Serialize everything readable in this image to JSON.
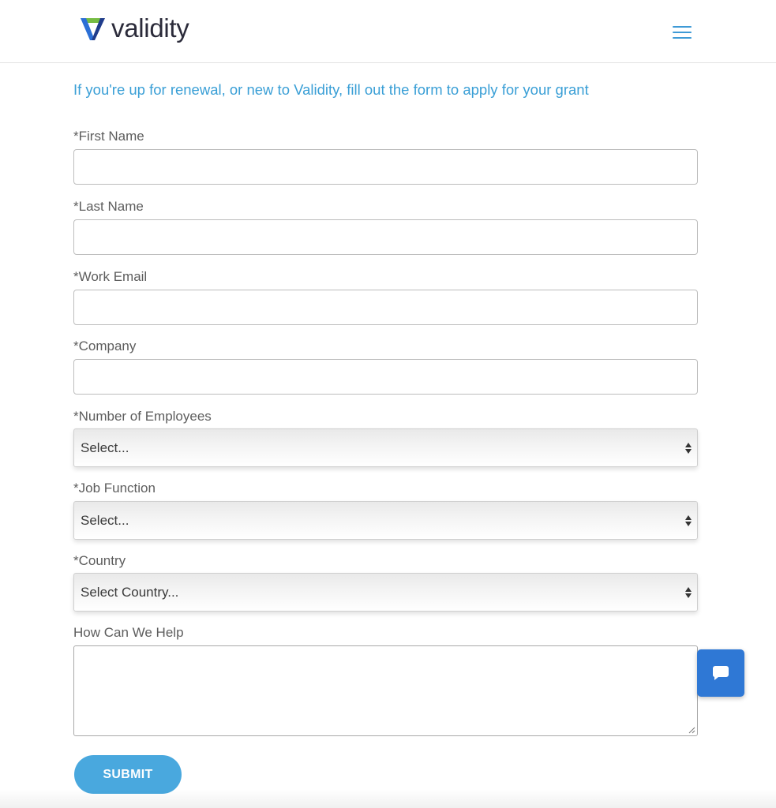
{
  "header": {
    "brand": "validity",
    "brand_colors": {
      "green": "#76bc43",
      "blue": "#2b6fd6",
      "navy": "#1f3c8c"
    },
    "menu_icon": "hamburger-menu-icon"
  },
  "intro_text": "If you're up for renewal, or new to Validity, fill out the form to apply for your grant",
  "form": {
    "first_name_label": "*First Name",
    "first_name_value": "",
    "last_name_label": "*Last Name",
    "last_name_value": "",
    "work_email_label": "*Work Email",
    "work_email_value": "",
    "company_label": "*Company",
    "company_value": "",
    "employees_label": "*Number of Employees",
    "employees_selected": "Select...",
    "job_function_label": "*Job Function",
    "job_function_selected": "Select...",
    "country_label": "*Country",
    "country_selected": "Select Country...",
    "help_label": "How Can We Help",
    "help_value": "",
    "submit_label": "SUBMIT"
  },
  "colors": {
    "accent": "#3a9fd6",
    "submit": "#49a8de",
    "chat": "#2f78d5"
  },
  "chat": {
    "icon": "chat-bubble-icon"
  }
}
